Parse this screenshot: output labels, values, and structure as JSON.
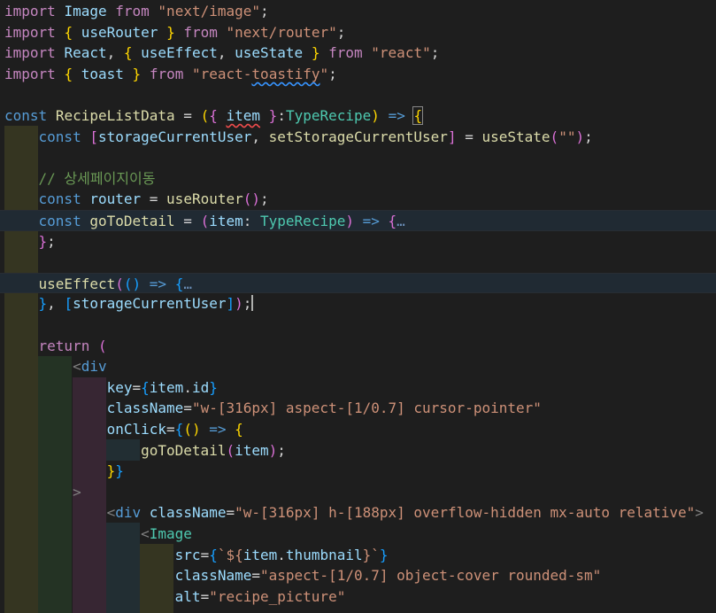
{
  "editor": {
    "theme": "Dark+",
    "lines": [
      {
        "tokens": [
          [
            "c-kw",
            "import"
          ],
          [
            "c-def",
            " "
          ],
          [
            "c-var",
            "Image"
          ],
          [
            "c-def",
            " "
          ],
          [
            "c-kw",
            "from"
          ],
          [
            "c-def",
            " "
          ],
          [
            "c-str",
            "\"next/image\""
          ],
          [
            "c-def",
            ";"
          ]
        ]
      },
      {
        "tokens": [
          [
            "c-kw",
            "import"
          ],
          [
            "c-def",
            " "
          ],
          [
            "c-br1",
            "{"
          ],
          [
            "c-def",
            " "
          ],
          [
            "c-var",
            "useRouter"
          ],
          [
            "c-def",
            " "
          ],
          [
            "c-br1",
            "}"
          ],
          [
            "c-def",
            " "
          ],
          [
            "c-kw",
            "from"
          ],
          [
            "c-def",
            " "
          ],
          [
            "c-str",
            "\"next/router\""
          ],
          [
            "c-def",
            ";"
          ]
        ]
      },
      {
        "tokens": [
          [
            "c-kw",
            "import"
          ],
          [
            "c-def",
            " "
          ],
          [
            "c-var",
            "React"
          ],
          [
            "c-def",
            ", "
          ],
          [
            "c-br1",
            "{"
          ],
          [
            "c-def",
            " "
          ],
          [
            "c-var",
            "useEffect"
          ],
          [
            "c-def",
            ", "
          ],
          [
            "c-var",
            "useState"
          ],
          [
            "c-def",
            " "
          ],
          [
            "c-br1",
            "}"
          ],
          [
            "c-def",
            " "
          ],
          [
            "c-kw",
            "from"
          ],
          [
            "c-def",
            " "
          ],
          [
            "c-str",
            "\"react\""
          ],
          [
            "c-def",
            ";"
          ]
        ]
      },
      {
        "tokens": [
          [
            "c-kw",
            "import"
          ],
          [
            "c-def",
            " "
          ],
          [
            "c-br1",
            "{"
          ],
          [
            "c-def",
            " "
          ],
          [
            "c-var",
            "toast"
          ],
          [
            "c-def",
            " "
          ],
          [
            "c-br1",
            "}"
          ],
          [
            "c-def",
            " "
          ],
          [
            "c-kw",
            "from"
          ],
          [
            "c-def",
            " "
          ],
          [
            "c-str",
            "\"react-"
          ],
          [
            "c-str squiggle-blue",
            "toastify"
          ],
          [
            "c-str",
            "\""
          ],
          [
            "c-def",
            ";"
          ]
        ]
      },
      {
        "tokens": []
      },
      {
        "tokens": [
          [
            "c-st",
            "const"
          ],
          [
            "c-def",
            " "
          ],
          [
            "c-fn",
            "RecipeListData"
          ],
          [
            "c-def",
            " = "
          ],
          [
            "c-br1",
            "("
          ],
          [
            "c-br2",
            "{"
          ],
          [
            "c-def",
            " "
          ],
          [
            "c-var squiggle-red",
            "item"
          ],
          [
            "c-def",
            " "
          ],
          [
            "c-br2",
            "}"
          ],
          [
            "c-def",
            ":"
          ],
          [
            "c-ty",
            "TypeRecipe"
          ],
          [
            "c-br1",
            ")"
          ],
          [
            "c-def",
            " "
          ],
          [
            "c-st",
            "=>"
          ],
          [
            "c-def",
            " "
          ],
          [
            "c-br1 box",
            "{"
          ]
        ]
      },
      {
        "tokens": [
          [
            "c-def",
            "    "
          ],
          [
            "c-st",
            "const"
          ],
          [
            "c-def",
            " "
          ],
          [
            "c-br2",
            "["
          ],
          [
            "c-var",
            "storageCurrentUser"
          ],
          [
            "c-def",
            ", "
          ],
          [
            "c-fn",
            "setStorageCurrentUser"
          ],
          [
            "c-br2",
            "]"
          ],
          [
            "c-def",
            " = "
          ],
          [
            "c-fn",
            "useState"
          ],
          [
            "c-br2",
            "("
          ],
          [
            "c-str",
            "\"\""
          ],
          [
            "c-br2",
            ")"
          ],
          [
            "c-def",
            ";"
          ]
        ]
      },
      {
        "tokens": []
      },
      {
        "tokens": [
          [
            "c-def",
            "    "
          ],
          [
            "c-cm",
            "// 상세페이지이동"
          ]
        ]
      },
      {
        "tokens": [
          [
            "c-def",
            "    "
          ],
          [
            "c-st",
            "const"
          ],
          [
            "c-def",
            " "
          ],
          [
            "c-var",
            "router"
          ],
          [
            "c-def",
            " = "
          ],
          [
            "c-fn",
            "useRouter"
          ],
          [
            "c-br2",
            "()"
          ],
          [
            "c-def",
            ";"
          ]
        ]
      },
      {
        "hl": true,
        "tokens": [
          [
            "c-def",
            "    "
          ],
          [
            "c-st",
            "const"
          ],
          [
            "c-def",
            " "
          ],
          [
            "c-fn",
            "goToDetail"
          ],
          [
            "c-def",
            " = "
          ],
          [
            "c-br2",
            "("
          ],
          [
            "c-var",
            "item"
          ],
          [
            "c-def",
            ": "
          ],
          [
            "c-ty",
            "TypeRecipe"
          ],
          [
            "c-br2",
            ")"
          ],
          [
            "c-def",
            " "
          ],
          [
            "c-st",
            "=>"
          ],
          [
            "c-def",
            " "
          ],
          [
            "c-br2",
            "{"
          ],
          [
            "c-fold",
            "…"
          ]
        ]
      },
      {
        "tokens": [
          [
            "c-def",
            "    "
          ],
          [
            "c-br2",
            "}"
          ],
          [
            "c-def",
            ";"
          ]
        ]
      },
      {
        "tokens": []
      },
      {
        "hl": true,
        "tokens": [
          [
            "c-def",
            "    "
          ],
          [
            "c-fn",
            "useEffect"
          ],
          [
            "c-br2",
            "("
          ],
          [
            "c-br3",
            "()"
          ],
          [
            "c-def",
            " "
          ],
          [
            "c-st",
            "=>"
          ],
          [
            "c-def",
            " "
          ],
          [
            "c-br3",
            "{"
          ],
          [
            "c-fold",
            "…"
          ]
        ]
      },
      {
        "tokens": [
          [
            "c-def",
            "    "
          ],
          [
            "c-br3",
            "}"
          ],
          [
            "c-def",
            ", "
          ],
          [
            "c-br3",
            "["
          ],
          [
            "c-var",
            "storageCurrentUser"
          ],
          [
            "c-br3",
            "]"
          ],
          [
            "c-br2",
            ")"
          ],
          [
            "c-def",
            ";"
          ],
          [
            "cursor",
            ""
          ]
        ]
      },
      {
        "tokens": []
      },
      {
        "tokens": [
          [
            "c-def",
            "    "
          ],
          [
            "c-kw",
            "return"
          ],
          [
            "c-def",
            " "
          ],
          [
            "c-br2",
            "("
          ]
        ]
      },
      {
        "tokens": [
          [
            "c-def",
            "        "
          ],
          [
            "c-punc",
            "<"
          ],
          [
            "c-tag",
            "div"
          ]
        ]
      },
      {
        "tokens": [
          [
            "c-def",
            "            "
          ],
          [
            "c-var",
            "key"
          ],
          [
            "c-def",
            "="
          ],
          [
            "c-br3",
            "{"
          ],
          [
            "c-var",
            "item"
          ],
          [
            "c-def",
            "."
          ],
          [
            "c-var",
            "id"
          ],
          [
            "c-br3",
            "}"
          ]
        ]
      },
      {
        "tokens": [
          [
            "c-def",
            "            "
          ],
          [
            "c-var",
            "className"
          ],
          [
            "c-def",
            "="
          ],
          [
            "c-str",
            "\"w-[316px] aspect-[1/0.7] cursor-pointer\""
          ]
        ]
      },
      {
        "tokens": [
          [
            "c-def",
            "            "
          ],
          [
            "c-var",
            "onClick"
          ],
          [
            "c-def",
            "="
          ],
          [
            "c-br3",
            "{"
          ],
          [
            "c-br1",
            "()"
          ],
          [
            "c-def",
            " "
          ],
          [
            "c-st",
            "=>"
          ],
          [
            "c-def",
            " "
          ],
          [
            "c-br1",
            "{"
          ]
        ]
      },
      {
        "tokens": [
          [
            "c-def",
            "                "
          ],
          [
            "c-fn",
            "goToDetail"
          ],
          [
            "c-br2",
            "("
          ],
          [
            "c-var",
            "item"
          ],
          [
            "c-br2",
            ")"
          ],
          [
            "c-def",
            ";"
          ]
        ]
      },
      {
        "tokens": [
          [
            "c-def",
            "            "
          ],
          [
            "c-br1",
            "}"
          ],
          [
            "c-br3",
            "}"
          ]
        ]
      },
      {
        "tokens": [
          [
            "c-def",
            "        "
          ],
          [
            "c-punc",
            ">"
          ]
        ]
      },
      {
        "tokens": [
          [
            "c-def",
            "            "
          ],
          [
            "c-punc",
            "<"
          ],
          [
            "c-tag",
            "div"
          ],
          [
            "c-def",
            " "
          ],
          [
            "c-var",
            "className"
          ],
          [
            "c-def",
            "="
          ],
          [
            "c-str",
            "\"w-[316px] h-[188px] overflow-hidden mx-auto relative\""
          ],
          [
            "c-punc",
            ">"
          ]
        ]
      },
      {
        "tokens": [
          [
            "c-def",
            "                "
          ],
          [
            "c-punc",
            "<"
          ],
          [
            "c-ty",
            "Image"
          ]
        ]
      },
      {
        "tokens": [
          [
            "c-def",
            "                    "
          ],
          [
            "c-var",
            "src"
          ],
          [
            "c-def",
            "="
          ],
          [
            "c-br3",
            "{"
          ],
          [
            "c-str",
            "`${"
          ],
          [
            "c-var",
            "item"
          ],
          [
            "c-def",
            "."
          ],
          [
            "c-var",
            "thumbnail"
          ],
          [
            "c-str",
            "}`"
          ],
          [
            "c-br3",
            "}"
          ]
        ]
      },
      {
        "tokens": [
          [
            "c-def",
            "                    "
          ],
          [
            "c-var",
            "className"
          ],
          [
            "c-def",
            "="
          ],
          [
            "c-str",
            "\"aspect-[1/0.7] object-cover rounded-sm\""
          ]
        ]
      },
      {
        "tokens": [
          [
            "c-def",
            "                    "
          ],
          [
            "c-var",
            "alt"
          ],
          [
            "c-def",
            "="
          ],
          [
            "c-str",
            "\"recipe_picture\""
          ]
        ]
      }
    ]
  }
}
